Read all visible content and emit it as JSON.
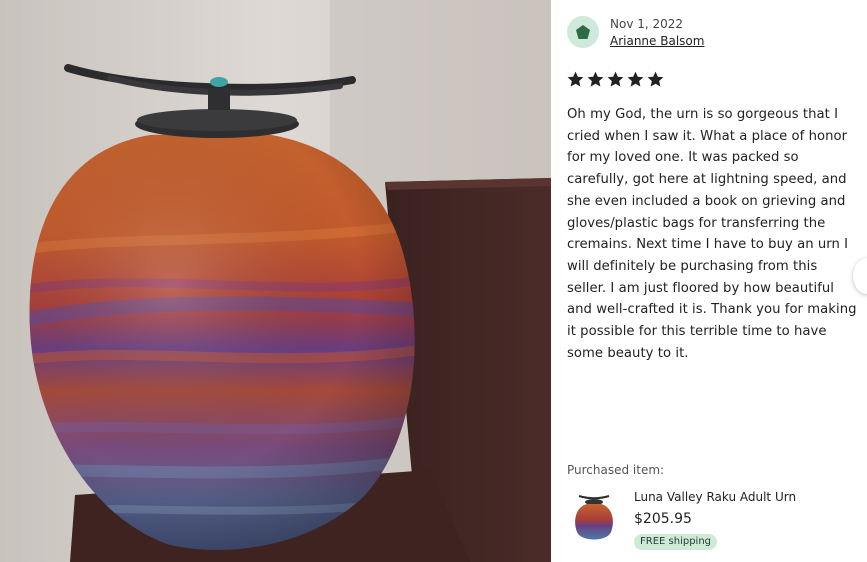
{
  "review": {
    "date": "Nov 1, 2022",
    "author": "Arianne Balsom",
    "rating": 5,
    "text": "Oh my God, the urn is so gorgeous that I cried when I saw it. What a place of honor for my loved one. It was packed so carefully, got here at lightning speed, and she even included a book on grieving and gloves/plastic bags for transferring the cremains. Next time I have to buy an urn I will definitely be purchasing from this seller. I am just floored by how beautiful and well-crafted it is. Thank you for making it possible for this terrible time to have some beauty to it."
  },
  "purchase": {
    "label": "Purchased item:",
    "title": "Luna Valley Raku Adult Urn",
    "price": "$205.95",
    "shipping": "FREE shipping"
  },
  "icons": {
    "avatar": "pentagon-avatar-icon",
    "star": "star-icon",
    "next": "chevron-right-icon"
  },
  "colors": {
    "star": "#222222",
    "avatar_bg": "#cfe9da",
    "avatar_fg": "#2f6b45",
    "badge_bg": "#cfe9d7"
  }
}
